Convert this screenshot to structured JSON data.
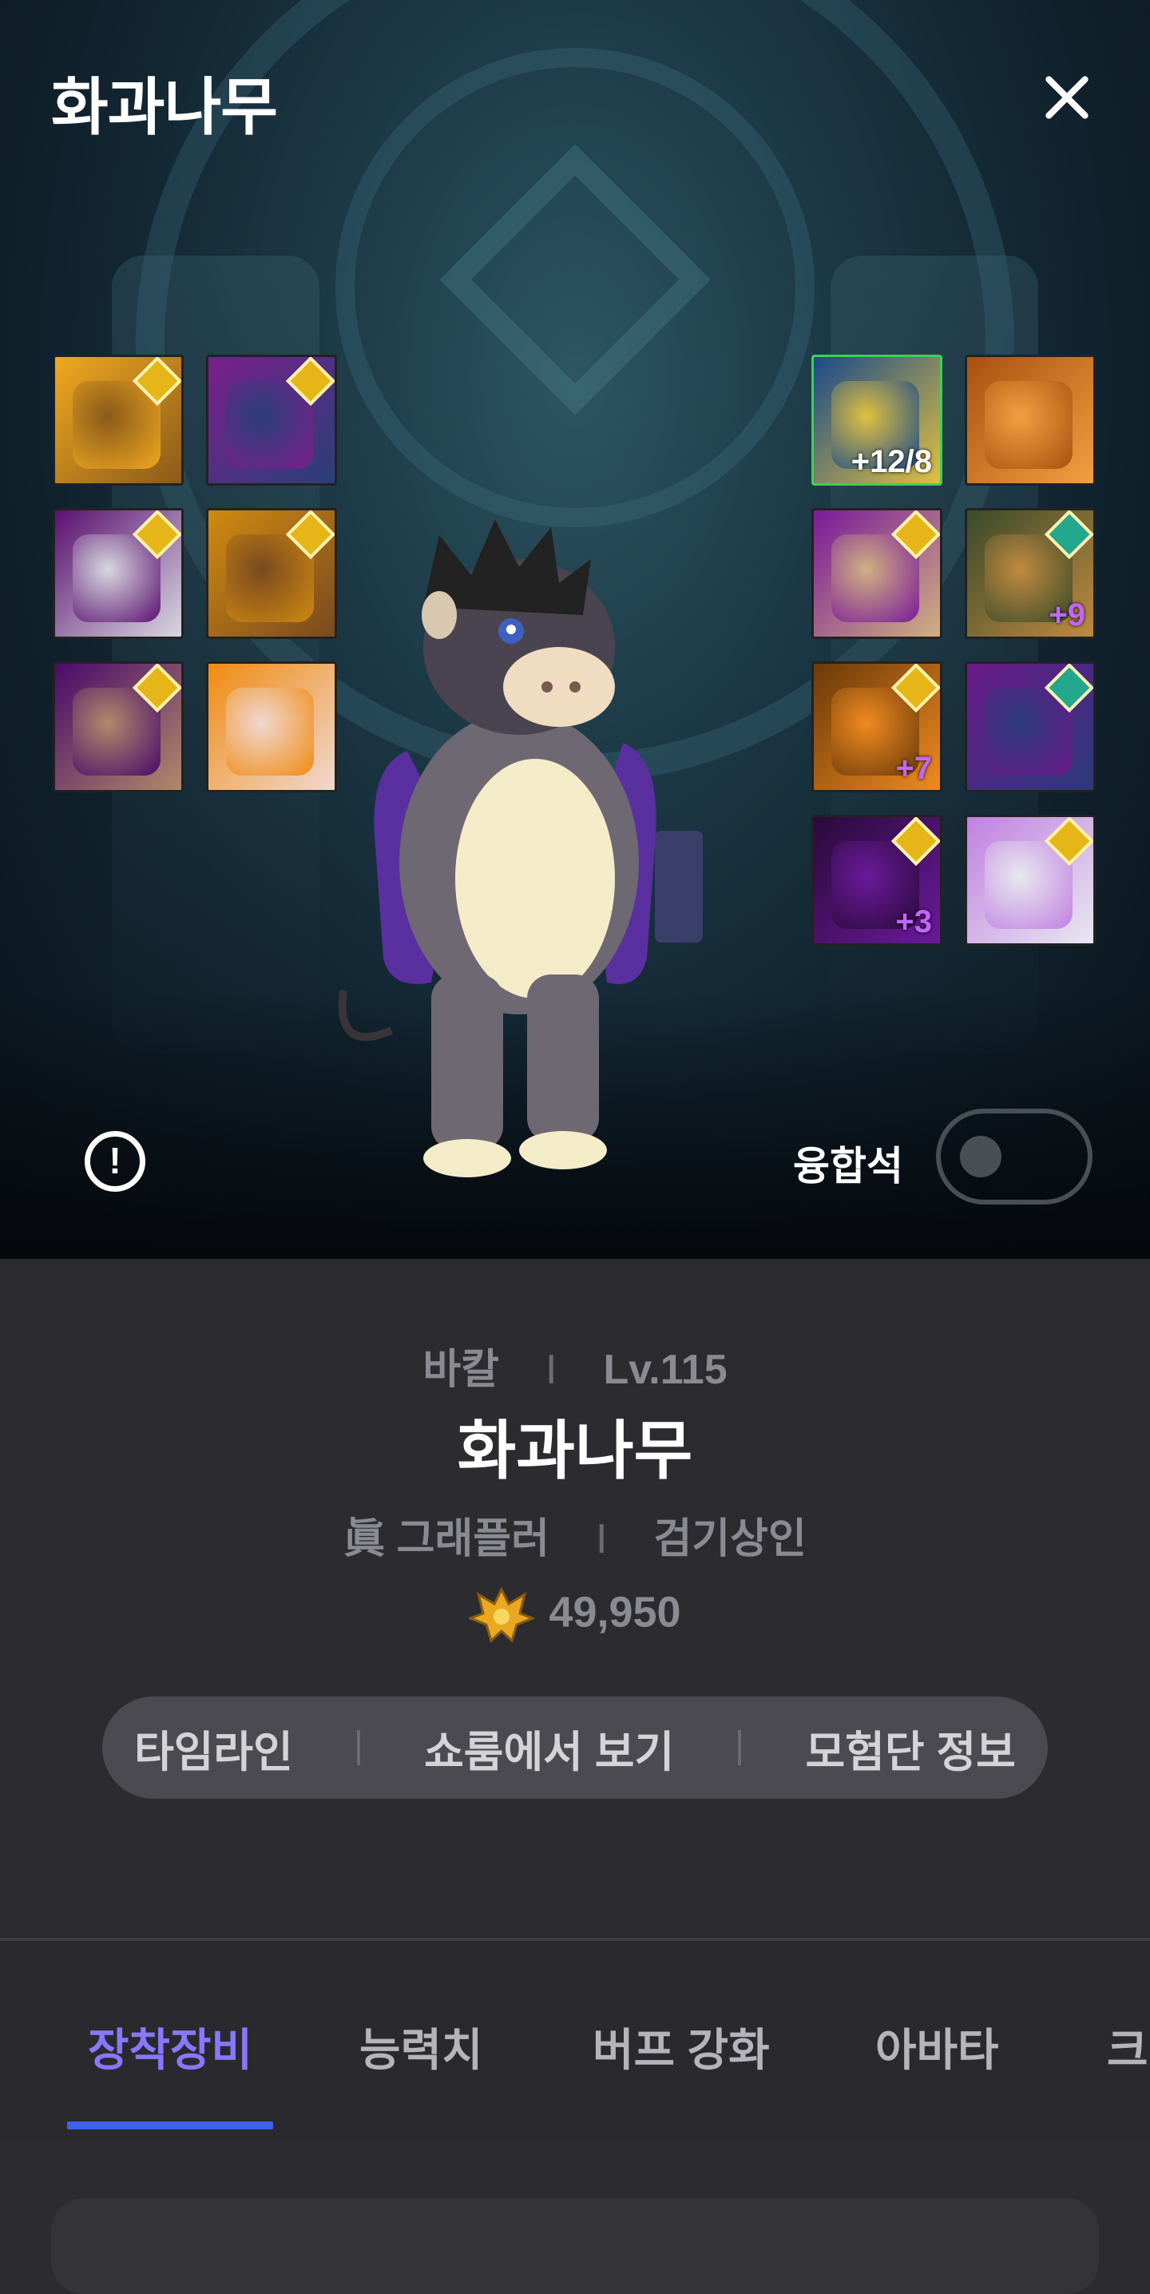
{
  "header": {
    "title": "화과나무",
    "close_icon": "close-icon"
  },
  "equipment": {
    "left": [
      {
        "name": "slot-left-1",
        "colors": [
          "#f0a820",
          "#8a5a1a"
        ],
        "gem": "gold",
        "level": ""
      },
      {
        "name": "slot-left-2",
        "colors": [
          "#7a1f8a",
          "#2a3f7a"
        ],
        "gem": "gold",
        "level": ""
      },
      {
        "name": "slot-left-3",
        "colors": [
          "#5a1070",
          "#d8d8e0"
        ],
        "gem": "gold",
        "level": ""
      },
      {
        "name": "slot-left-4",
        "colors": [
          "#d08a10",
          "#7a4a20"
        ],
        "gem": "gold",
        "level": ""
      },
      {
        "name": "slot-left-5",
        "colors": [
          "#4a0a6a",
          "#b08a6a"
        ],
        "gem": "gold",
        "level": ""
      },
      {
        "name": "slot-left-6",
        "colors": [
          "#f08a10",
          "#f0d8d0"
        ],
        "gem": "",
        "level": ""
      }
    ],
    "right": [
      {
        "name": "slot-right-1",
        "colors": [
          "#1a4a8a",
          "#e0c040"
        ],
        "gem": "",
        "level": "+12/8",
        "level_white": true,
        "border": "#39d353"
      },
      {
        "name": "slot-right-2",
        "colors": [
          "#a85010",
          "#f0a040"
        ],
        "gem": "",
        "level": ""
      },
      {
        "name": "slot-right-3",
        "colors": [
          "#7a1a9a",
          "#d0b080"
        ],
        "gem": "gold",
        "level": ""
      },
      {
        "name": "slot-right-4",
        "colors": [
          "#3a4a2a",
          "#c08a40"
        ],
        "gem": "teal",
        "level": "+9"
      },
      {
        "name": "slot-right-5",
        "colors": [
          "#6a3a0a",
          "#f08a20"
        ],
        "gem": "gold",
        "level": "+7"
      },
      {
        "name": "slot-right-6",
        "colors": [
          "#6a1a8a",
          "#2a3a7a"
        ],
        "gem": "teal",
        "level": ""
      },
      {
        "name": "slot-right-7",
        "colors": [
          "#2a0a3a",
          "#6a1a9a"
        ],
        "gem": "gold",
        "level": "+3"
      },
      {
        "name": "slot-right-8",
        "colors": [
          "#c080e0",
          "#e8e8f0"
        ],
        "gem": "gold",
        "level": ""
      }
    ]
  },
  "controls": {
    "info_icon": "!",
    "fusion_label": "융합석",
    "fusion_on": false
  },
  "profile": {
    "server": "바칼",
    "level": "Lv.115",
    "name": "화과나무",
    "class": "眞 그래플러",
    "guild": "검기상인",
    "fame": "49,950",
    "fame_icon": "fame-crown-icon"
  },
  "links": {
    "timeline": "타임라인",
    "showroom": "쇼룸에서 보기",
    "adventure": "모험단 정보"
  },
  "tabs": [
    {
      "label": "장착장비",
      "active": true
    },
    {
      "label": "능력치",
      "active": false
    },
    {
      "label": "버프 강화",
      "active": false
    },
    {
      "label": "아바타",
      "active": false
    },
    {
      "label": "크",
      "active": false
    }
  ]
}
